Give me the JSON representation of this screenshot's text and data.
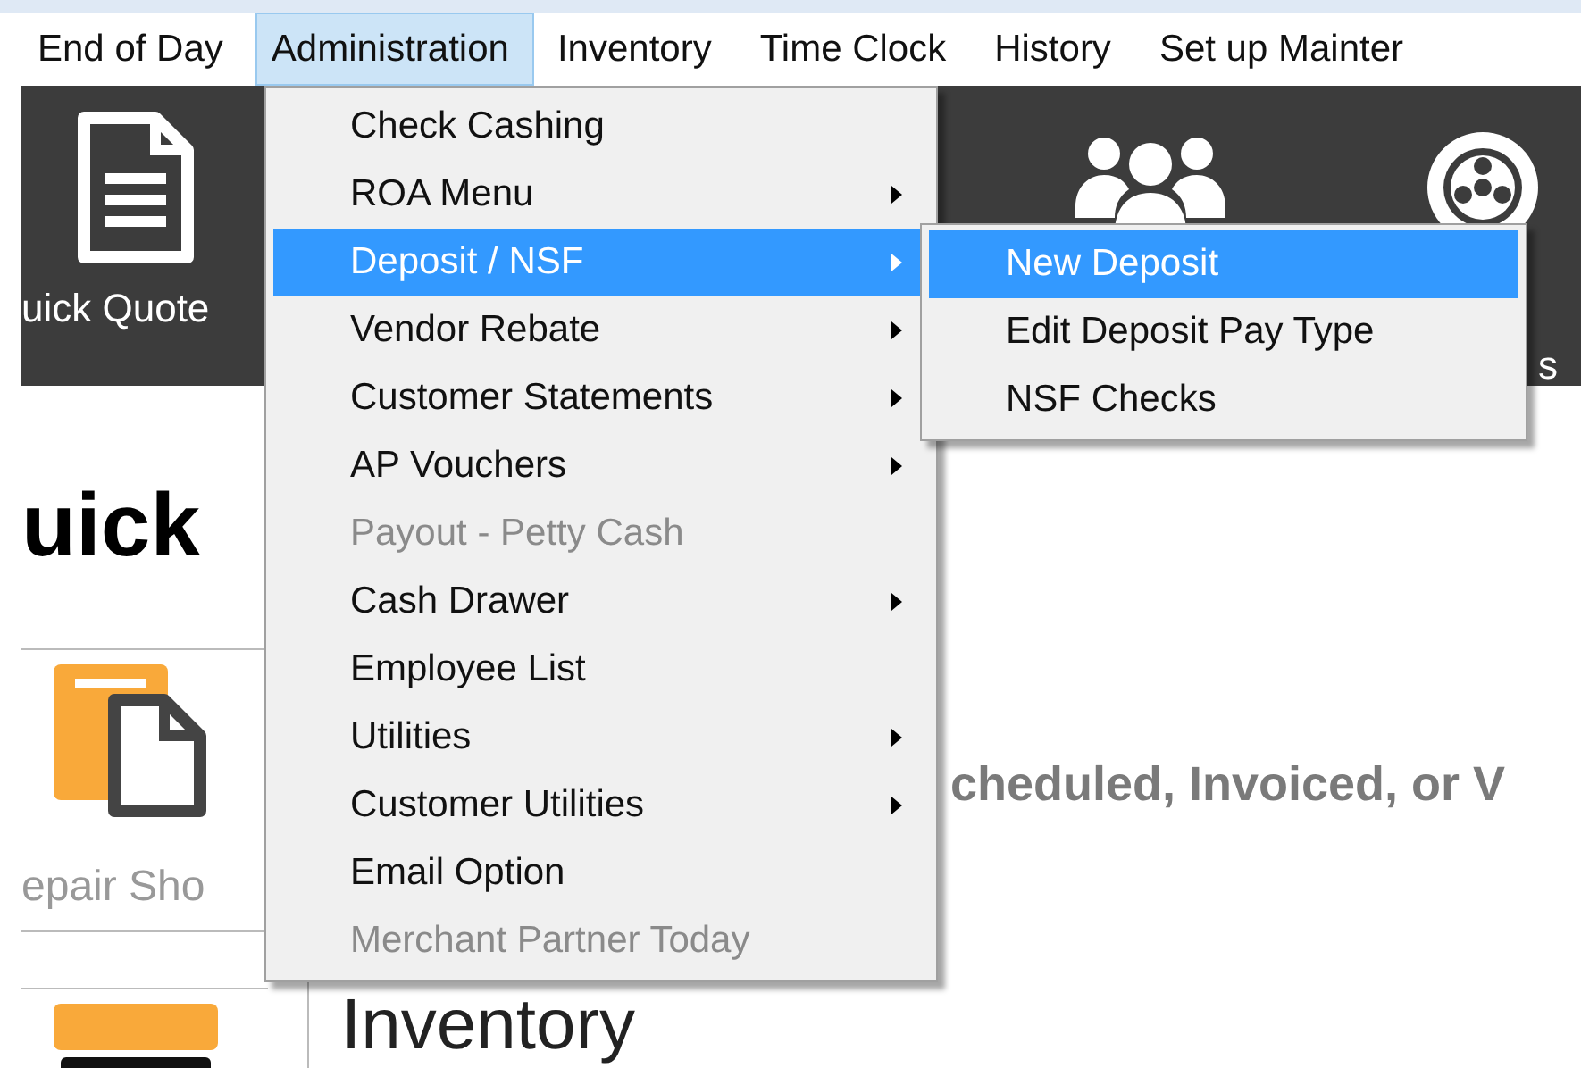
{
  "menubar": [
    {
      "label": "End of Day",
      "selected": false
    },
    {
      "label": "Administration",
      "selected": true
    },
    {
      "label": "Inventory",
      "selected": false
    },
    {
      "label": "Time Clock",
      "selected": false
    },
    {
      "label": "History",
      "selected": false
    },
    {
      "label": "Set up Mainter",
      "selected": false
    }
  ],
  "toolbar": {
    "items": [
      {
        "kind": "document",
        "label": "uick Quote"
      },
      {
        "kind": "people"
      },
      {
        "kind": "wheel",
        "label": "s"
      }
    ]
  },
  "page": {
    "heading": "uick",
    "tiles": [
      {
        "kind": "folder",
        "label": "epair Sho"
      },
      {
        "kind": "bar"
      }
    ],
    "notice": "cheduled, Invoiced, or V",
    "section_title": "Inventory"
  },
  "menu": {
    "items": [
      {
        "label": "Check Cashing",
        "submenu": false,
        "disabled": false,
        "selected": false
      },
      {
        "label": "ROA  Menu",
        "submenu": true,
        "disabled": false,
        "selected": false
      },
      {
        "label": "Deposit / NSF",
        "submenu": true,
        "disabled": false,
        "selected": true
      },
      {
        "label": "Vendor Rebate",
        "submenu": true,
        "disabled": false,
        "selected": false
      },
      {
        "label": "Customer Statements",
        "submenu": true,
        "disabled": false,
        "selected": false
      },
      {
        "label": "AP Vouchers",
        "submenu": true,
        "disabled": false,
        "selected": false
      },
      {
        "label": "Payout - Petty Cash",
        "submenu": false,
        "disabled": true,
        "selected": false
      },
      {
        "label": "Cash Drawer",
        "submenu": true,
        "disabled": false,
        "selected": false
      },
      {
        "label": "Employee List",
        "submenu": false,
        "disabled": false,
        "selected": false
      },
      {
        "label": "Utilities",
        "submenu": true,
        "disabled": false,
        "selected": false
      },
      {
        "label": "Customer Utilities",
        "submenu": true,
        "disabled": false,
        "selected": false
      },
      {
        "label": "Email Option",
        "submenu": false,
        "disabled": false,
        "selected": false
      },
      {
        "label": "Merchant Partner Today",
        "submenu": false,
        "disabled": true,
        "selected": false
      }
    ]
  },
  "submenu": {
    "items": [
      {
        "label": "New Deposit",
        "selected": true
      },
      {
        "label": "Edit Deposit Pay Type",
        "selected": false
      },
      {
        "label": "NSF Checks",
        "selected": false
      }
    ]
  }
}
